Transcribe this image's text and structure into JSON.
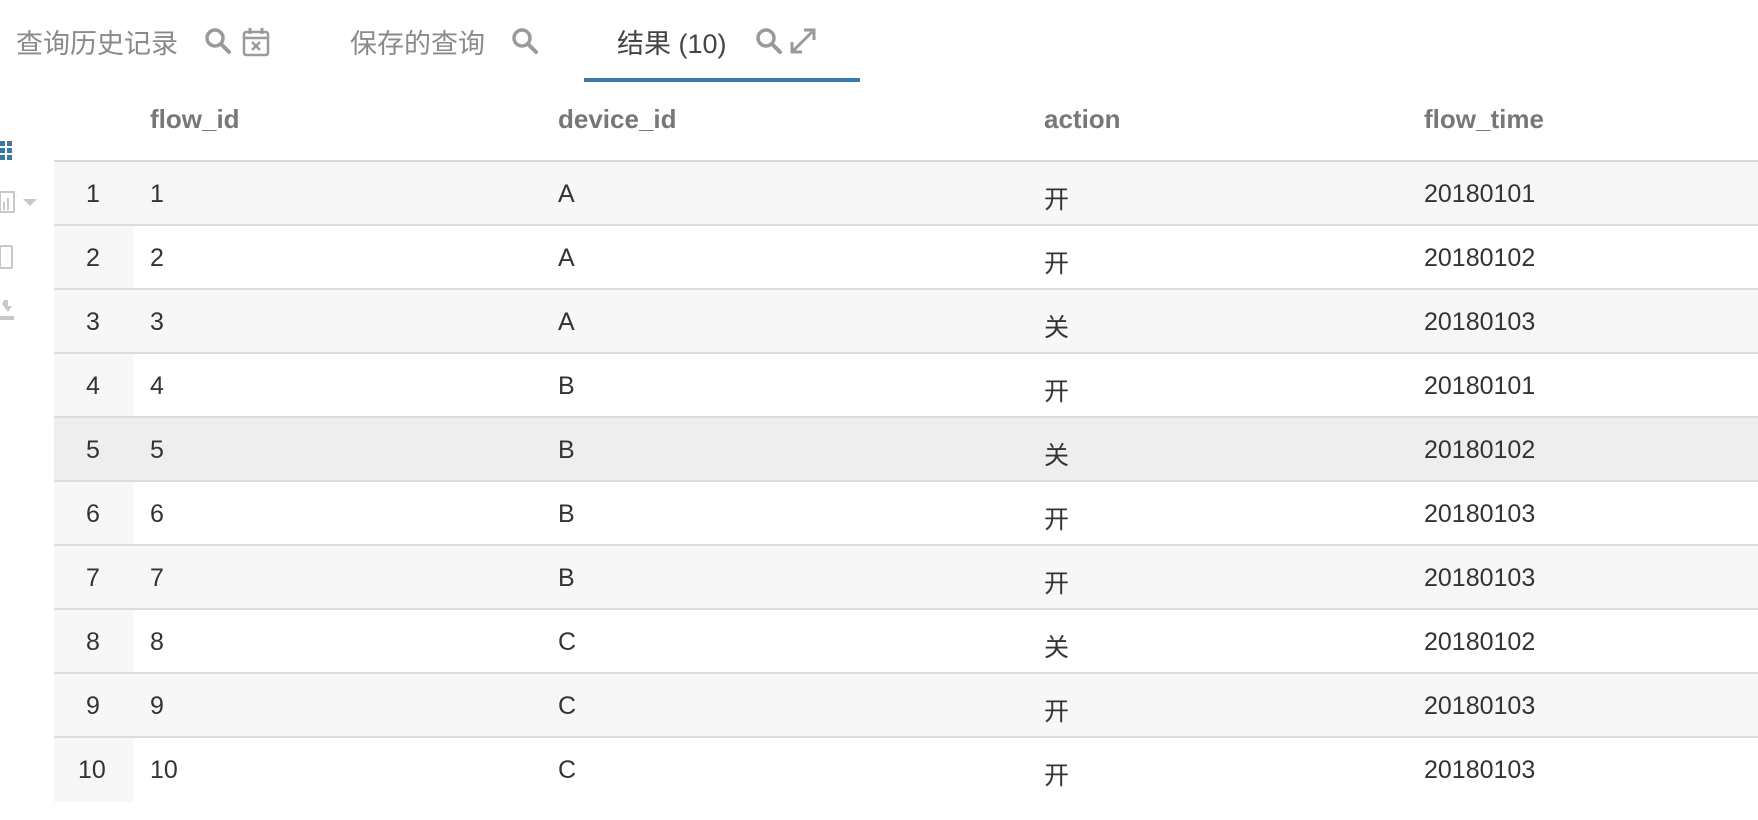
{
  "tabs": [
    {
      "label": "查询历史记录",
      "icons": [
        "search-icon",
        "calendar-clear-icon"
      ]
    },
    {
      "label": "保存的查询",
      "icons": [
        "search-icon"
      ]
    },
    {
      "label": "结果 (10)",
      "icons": [
        "search-icon",
        "expand-icon"
      ],
      "active": true
    }
  ],
  "toolbar": {
    "icons": [
      "grid-view-icon",
      "chart-icon",
      "chevron-down-icon",
      "clipboard-icon",
      "download-icon"
    ],
    "accent": "#3a78a7"
  },
  "table": {
    "columns": [
      "flow_id",
      "device_id",
      "action",
      "flow_time"
    ],
    "rows": [
      {
        "num": "1",
        "flow_id": "1",
        "device_id": "A",
        "action": "开",
        "flow_time": "20180101"
      },
      {
        "num": "2",
        "flow_id": "2",
        "device_id": "A",
        "action": "开",
        "flow_time": "20180102"
      },
      {
        "num": "3",
        "flow_id": "3",
        "device_id": "A",
        "action": "关",
        "flow_time": "20180103"
      },
      {
        "num": "4",
        "flow_id": "4",
        "device_id": "B",
        "action": "开",
        "flow_time": "20180101"
      },
      {
        "num": "5",
        "flow_id": "5",
        "device_id": "B",
        "action": "关",
        "flow_time": "20180102"
      },
      {
        "num": "6",
        "flow_id": "6",
        "device_id": "B",
        "action": "开",
        "flow_time": "20180103"
      },
      {
        "num": "7",
        "flow_id": "7",
        "device_id": "B",
        "action": "开",
        "flow_time": "20180103"
      },
      {
        "num": "8",
        "flow_id": "8",
        "device_id": "C",
        "action": "关",
        "flow_time": "20180102"
      },
      {
        "num": "9",
        "flow_id": "9",
        "device_id": "C",
        "action": "开",
        "flow_time": "20180103"
      },
      {
        "num": "10",
        "flow_id": "10",
        "device_id": "C",
        "action": "开",
        "flow_time": "20180103"
      }
    ]
  }
}
